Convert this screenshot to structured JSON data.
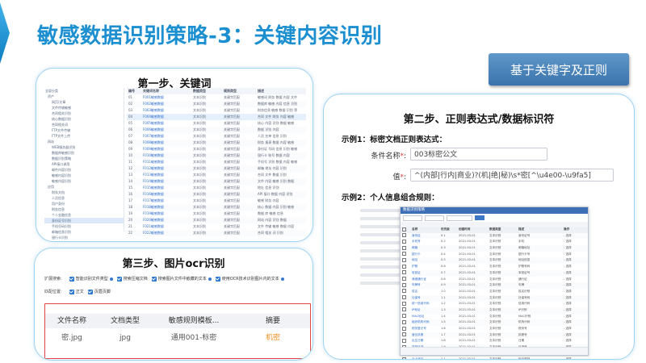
{
  "header": {
    "title": "敏感数据识别策略-3：关键内容识别",
    "badge": "基于关键字及正则",
    "accent_color": "#1aa0de"
  },
  "step1": {
    "title": "第一步、关键词",
    "tree": [
      "全部分类",
      "资产",
      "网页/文章",
      "文件传输敏感",
      "合同相关识别",
      "核心数据识别",
      "合同相关词",
      "FTP文件传输",
      "FTP文件上传",
      "网站",
      "WEB服务器识别",
      "数据库敏感识别",
      "数据识别策略",
      "API接口调用",
      "邮件内容识别",
      "敏感内容识别",
      "敏感内容识别",
      "应用",
      "财务文档",
      "人员信息",
      "用户身份",
      "财务信息",
      "个人金融信息",
      "身份证号识别",
      "手机号码识别",
      "邮箱信息识别",
      "银行卡识别",
      "地址信息识别"
    ],
    "columns": [
      "编号",
      "关键词名称",
      "数据类型",
      "规则类型",
      "描述"
    ],
    "rows": [
      [
        "01",
        "F001敏感数据",
        "文本识别",
        "关键字匹配",
        "敏感词 财务 数据 内容 文件"
      ],
      [
        "02",
        "F002敏感数据",
        "文本识别",
        "关键字匹配",
        "数据库 敏感 内容 信息 识别"
      ],
      [
        "03",
        "F003敏感数据",
        "文本识别",
        "关键字匹配",
        "财务信息 敏感 数据 识别 等"
      ],
      [
        "04",
        "F004敏感数据",
        "文本识别",
        "关键字匹配",
        "合同 文件 财务 内容 敏感"
      ],
      [
        "05",
        "F005敏感数据",
        "文本识别",
        "关键字匹配",
        "核心 内容 识别 数据 敏感"
      ],
      [
        "06",
        "F006敏感数据",
        "文本识别",
        "关键字匹配",
        "数据 识别 内容"
      ],
      [
        "07",
        "F007敏感数据",
        "文本识别",
        "关键字匹配",
        "人员 名单 信息 识别"
      ],
      [
        "08",
        "F008敏感数据",
        "文本识别",
        "关键字匹配",
        "财务 报表 数据 内容 敏感"
      ],
      [
        "09",
        "F009敏感数据",
        "文本识别",
        "关键字匹配",
        "身份证 号码 信息 识别 敏感"
      ],
      [
        "10",
        "F010敏感数据",
        "文本识别",
        "关键字匹配",
        "银行卡 账号 数据 内容"
      ],
      [
        "11",
        "F011敏感数据",
        "文本识别",
        "关键字匹配",
        "手机号 识别 数据 内容 敏感"
      ],
      [
        "12",
        "F012敏感数据",
        "文本识别",
        "关键字匹配",
        "邮箱 地址 内容 识别"
      ],
      [
        "13",
        "F013敏感数据",
        "文本识别",
        "关键字匹配",
        "合同 文件 数据 识别"
      ],
      [
        "14",
        "F014敏感数据",
        "文本识别",
        "关键字匹配",
        "文件 内容 敏感 识别 数据"
      ],
      [
        "15",
        "F015敏感数据",
        "文本识别",
        "关键字匹配",
        "地址 信息 识别"
      ],
      [
        "16",
        "F016敏感数据",
        "文本识别",
        "关键字匹配",
        "API 接口 数据 内容 识别"
      ],
      [
        "17",
        "F017敏感数据",
        "文本识别",
        "关键字匹配",
        "敏感 财务 内容"
      ],
      [
        "18",
        "F018敏感数据",
        "文本识别",
        "关键字匹配",
        "核心 数据 内容 识别 敏感"
      ],
      [
        "19",
        "F019敏感数据",
        "文本识别",
        "关键字匹配",
        "数据 库 敏感 信息"
      ],
      [
        "20",
        "F020敏感数据",
        "文本识别",
        "关键字匹配",
        "网站 内容 识别 数据"
      ],
      [
        "21",
        "F021敏感数据",
        "文本识别",
        "关键字匹配",
        "文件 传输 敏感 数据 内容"
      ],
      [
        "22",
        "F022敏感数据",
        "文本识别",
        "关键字匹配",
        "合同 相关 词 识别"
      ]
    ]
  },
  "step2": {
    "title": "第二步、正则表达式/数据标识符",
    "example1": "示例1：标密文档正则表达式：",
    "field1_label": "条件名称",
    "field1_value": "003标密公文",
    "field2_label": "值",
    "field2_value": "^(内部|行内|商业)?(机|绝|秘)\\s*密[^\\u4e00-\\u9fa5]",
    "example2": "示例2：个人信息组合规则：",
    "dialog": {
      "title": "数据识别策略",
      "columns": [
        "名称",
        "优先级",
        "创建时间",
        "数据类型",
        "描述",
        "操作"
      ],
      "rows": [
        [
          "身份证",
          "0.1",
          "2021-03-01",
          "文本识别",
          "身份证号",
          "- 选择"
        ],
        [
          "手机号",
          "0.2",
          "2021-03-01",
          "文本识别",
          "手机",
          "- 选择"
        ],
        [
          "邮箱",
          "0.3",
          "2021-03-01",
          "文本识别",
          "邮箱地址",
          "- 选择"
        ],
        [
          "银行卡",
          "0.4",
          "2021-03-01",
          "文本识别",
          "银行卡号",
          "- 选择"
        ],
        [
          "地址",
          "0.5",
          "2021-03-01",
          "文本识别",
          "地址信息",
          "- 选择"
        ],
        [
          "护照",
          "0.6",
          "2021-03-01",
          "文本识别",
          "护照号码",
          "- 选择"
        ],
        [
          "军官证",
          "0.7",
          "2021-03-01",
          "文本识别",
          "军官证号",
          "- 选择"
        ],
        [
          "港澳通行证",
          "0.8",
          "2021-03-01",
          "文本识别",
          "通行证",
          "- 选择"
        ],
        [
          "车牌号",
          "0.9",
          "2021-03-01",
          "文本识别",
          "车牌",
          "- 选择"
        ],
        [
          "姓名",
          "1.0",
          "2021-03-01",
          "文本识别",
          "姓名识别",
          "- 选择"
        ],
        [
          "社保号",
          "1.1",
          "2021-03-01",
          "文本识别",
          "社保号码",
          "- 选择"
        ],
        [
          "统一信用代码",
          "1.2",
          "2021-03-01",
          "文本识别",
          "信用代码",
          "- 选择"
        ],
        [
          "IP地址",
          "1.3",
          "2021-03-01",
          "文本识别",
          "IP识别",
          "- 选择"
        ],
        [
          "MAC地址",
          "1.4",
          "2021-03-01",
          "文本识别",
          "MAC识别",
          "- 选择"
        ],
        [
          "组织机构代码",
          "1.5",
          "2021-03-01",
          "文本识别",
          "机构代码",
          "- 选择"
        ],
        [
          "税务登记号",
          "1.6",
          "2021-03-01",
          "文本识别",
          "税务号",
          "- 选择"
        ],
        [
          "营业执照",
          "1.7",
          "2021-03-01",
          "文本识别",
          "执照号",
          "- 选择"
        ],
        [
          "出生日期",
          "1.8",
          "2021-03-01",
          "文本识别",
          "日期",
          "- 选择"
        ],
        [
          "学历证书",
          "1.9",
          "2021-03-01",
          "文本识别",
          "证书号",
          "- 选择"
        ],
        [
          "医保卡",
          "2.0",
          "2021-03-01",
          "文本识别",
          "医保号",
          "- 选择"
        ],
        [
          "个人综合",
          "2.1",
          "2021-03-01",
          "文本识别",
          "组合规则",
          "- 选择"
        ]
      ]
    }
  },
  "step3": {
    "title": "第三步、图片ocr识别",
    "opt1_label": "扩展搜索:",
    "opt1_items": [
      "智能识别文件类型",
      "搜索压缩文档",
      "搜索图片文件中嵌藏的文本",
      "使用OCR技术识别图片内的文本"
    ],
    "opt2_label": "匹配位置:",
    "opt2_items": [
      "正文",
      "页眉页脚"
    ],
    "table_columns": [
      "文件名称",
      "文档类型",
      "敏感规则模板...",
      "摘要"
    ],
    "table_row": [
      "密.jpg",
      "jpg",
      "通用001-标密",
      "机密"
    ]
  }
}
